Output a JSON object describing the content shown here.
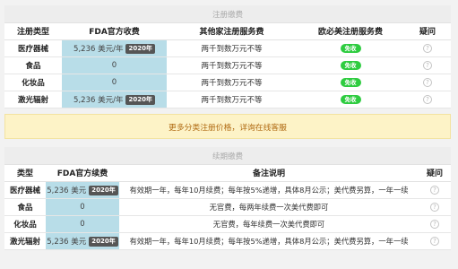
{
  "registration": {
    "section_title": "注册缴费",
    "headers": [
      "注册类型",
      "FDA官方收费",
      "其他家注册服务费",
      "欧必美注册服务费",
      "疑问"
    ],
    "rows": [
      {
        "type": "医疗器械",
        "fee": "5,236 美元/年",
        "badge": "2020年",
        "other": "两千到数万元不等",
        "ours": "免收",
        "q": "?"
      },
      {
        "type": "食品",
        "fee": "0",
        "badge": "",
        "other": "两千到数万元不等",
        "ours": "免收",
        "q": "?"
      },
      {
        "type": "化妆品",
        "fee": "0",
        "badge": "",
        "other": "两千到数万元不等",
        "ours": "免收",
        "q": "?"
      },
      {
        "type": "激光辐射",
        "fee": "5,236 美元/年",
        "badge": "2020年",
        "other": "两千到数万元不等",
        "ours": "免收",
        "q": "?"
      }
    ]
  },
  "notice": "更多分类注册价格，详询在线客服",
  "renewal": {
    "section_title": "续期缴费",
    "headers": [
      "类型",
      "FDA官方续费",
      "备注说明",
      "疑问"
    ],
    "rows": [
      {
        "type": "医疗器械",
        "fee": "5,236 美元",
        "badge": "2020年",
        "note": "有效期一年，每年10月续费；每年按5%递增，具体8月公示；美代费另算，一年一续",
        "q": "?"
      },
      {
        "type": "食品",
        "fee": "0",
        "badge": "",
        "note": "无官费，每两年续费一次美代费即可",
        "q": "?"
      },
      {
        "type": "化妆品",
        "fee": "0",
        "badge": "",
        "note": "无官费，每年续费一次美代费即可",
        "q": "?"
      },
      {
        "type": "激光辐射",
        "fee": "5,236 美元",
        "badge": "2020年",
        "note": "有效期一年，每年10月续费；每年按5%递增，具体8月公示；美代费另算，一年一续",
        "q": "?"
      }
    ]
  },
  "colors": {
    "fee_cell": "#b8dde8",
    "free_badge": "#2ecc40",
    "notice_bg": "#fdf3c7",
    "notice_text": "#b06a12"
  }
}
